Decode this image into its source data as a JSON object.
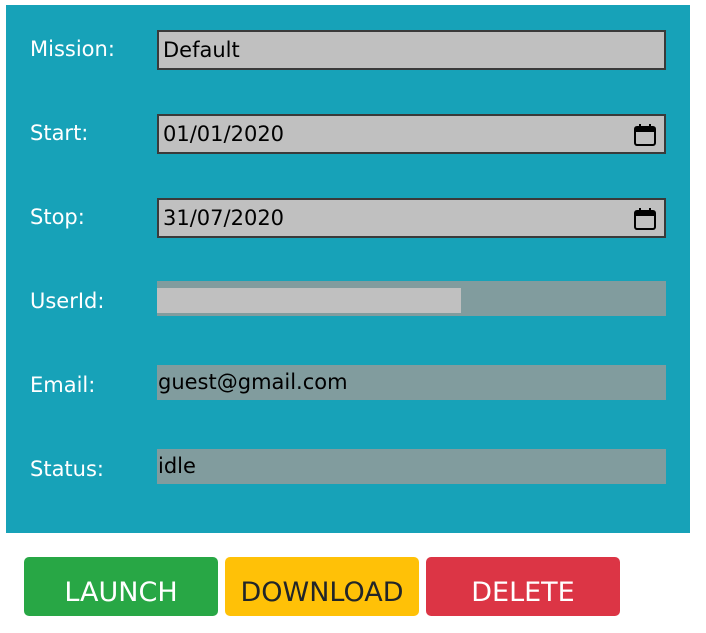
{
  "form": {
    "mission": {
      "label": "Mission:",
      "value": "Default"
    },
    "start": {
      "label": "Start:",
      "value": "01/01/2020"
    },
    "stop": {
      "label": "Stop:",
      "value": "31/07/2020"
    },
    "userid": {
      "label": "UserId:",
      "value": ""
    },
    "email": {
      "label": "Email:",
      "value": "guest@gmail.com"
    },
    "status": {
      "label": "Status:",
      "value": "idle"
    }
  },
  "actions": {
    "launch_label": "LAUNCH",
    "download_label": "DOWNLOAD",
    "delete_label": "DELETE"
  },
  "colors": {
    "panel": "#17a2b8",
    "input_bg": "#c0c0c0",
    "readonly_bg": "#819c9e",
    "launch": "#28a745",
    "download": "#ffc107",
    "delete": "#dc3545"
  },
  "icons": {
    "start_picker": "calendar-icon",
    "stop_picker": "calendar-icon"
  }
}
